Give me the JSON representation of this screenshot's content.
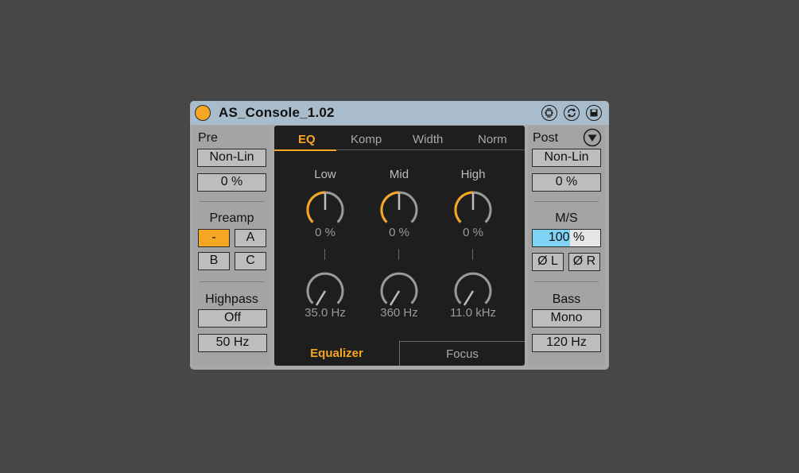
{
  "title": "AS_Console_1.02",
  "colors": {
    "accent": "#f5a623",
    "ms_fill": "#7fd4f5",
    "titlebar": "#a8bccb"
  },
  "titlebar_icons": [
    "hot-swap-icon",
    "refresh-icon",
    "save-icon"
  ],
  "left": {
    "pre_label": "Pre",
    "pre_mode": "Non-Lin",
    "pre_amount": "0 %",
    "preamp_label": "Preamp",
    "preamp_buttons": [
      "-",
      "A",
      "B",
      "C"
    ],
    "preamp_selected": "-",
    "highpass_label": "Highpass",
    "highpass_state": "Off",
    "highpass_freq": "50 Hz"
  },
  "tabs": [
    "EQ",
    "Komp",
    "Width",
    "Norm"
  ],
  "active_tab": "EQ",
  "eq": {
    "bands": [
      {
        "label": "Low",
        "gain": "0 %",
        "freq": "35.0 Hz"
      },
      {
        "label": "Mid",
        "gain": "0 %",
        "freq": "360 Hz"
      },
      {
        "label": "High",
        "gain": "0 %",
        "freq": "11.0 kHz"
      }
    ]
  },
  "bottom_tabs": [
    "Equalizer",
    "Focus"
  ],
  "active_bottom_tab": "Equalizer",
  "right": {
    "post_label": "Post",
    "post_mode": "Non-Lin",
    "post_amount": "0 %",
    "ms_label": "M/S",
    "ms_value": "100 %",
    "ms_fraction": 0.55,
    "phase_left": "Ø L",
    "phase_right": "Ø R",
    "bass_label": "Bass",
    "bass_mode": "Mono",
    "bass_freq": "120 Hz"
  }
}
